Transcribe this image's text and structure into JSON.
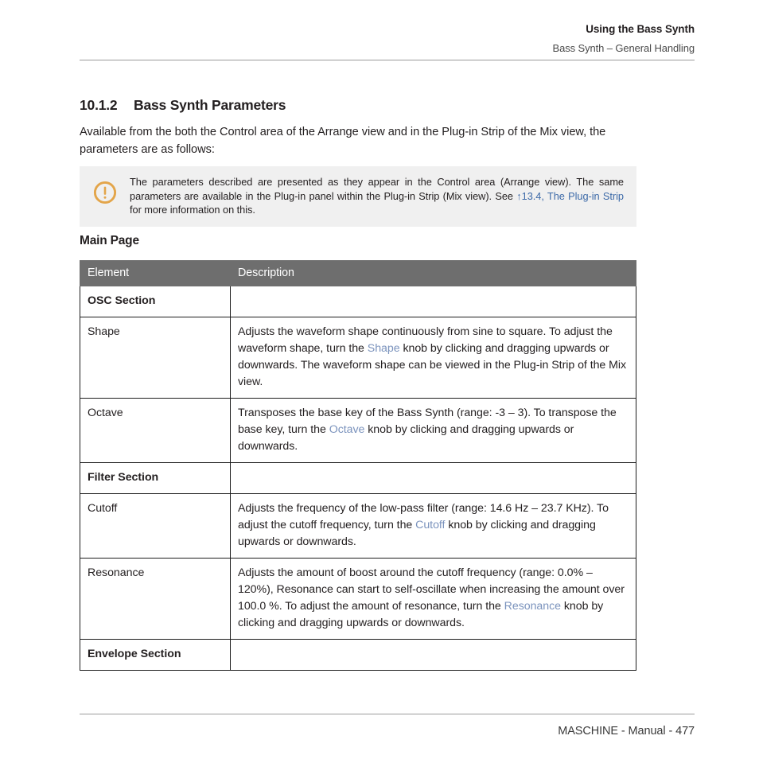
{
  "header": {
    "title": "Using the Bass Synth",
    "subtitle": "Bass Synth – General Handling"
  },
  "section": {
    "number": "10.1.2",
    "title": "Bass Synth Parameters"
  },
  "intro": "Available from the both the Control area of the Arrange view and in the Plug-in Strip of the Mix view, the parameters are as follows:",
  "note": {
    "icon": "exclamation-circle-icon",
    "icon_color": "#e3a54a",
    "text_part1": "The parameters described are presented as they appear in the Control area (Arrange view). The same parameters are available in the Plug-in panel within the Plug-in Strip (Mix view). See ",
    "link_text": "↑13.4, The Plug-in Strip",
    "text_part2": " for more information on this."
  },
  "subheading": "Main Page",
  "table": {
    "columns": [
      "Element",
      "Description"
    ],
    "header_bg": "#6e6e6e",
    "param_color": "#7b93bd",
    "rows": [
      {
        "type": "section",
        "element": "OSC Section",
        "description": ""
      },
      {
        "type": "param",
        "element": "Shape",
        "desc_a": "Adjusts the waveform shape continuously from sine to square. To adjust the waveform shape, turn the ",
        "desc_name": "Shape",
        "desc_b": " knob by clicking and dragging upwards or downwards. The waveform shape can be viewed in the Plug-in Strip of the Mix view."
      },
      {
        "type": "param",
        "element": "Octave",
        "desc_a": "Transposes the base key of the Bass Synth (range: -3 – 3). To transpose the base key, turn the ",
        "desc_name": "Octave",
        "desc_b": " knob by clicking and dragging upwards or downwards."
      },
      {
        "type": "section",
        "element": "Filter Section",
        "description": ""
      },
      {
        "type": "param",
        "element": "Cutoff",
        "desc_a": "Adjusts the frequency of the low-pass filter (range: 14.6 Hz – 23.7 KHz). To adjust the cutoff frequency, turn the ",
        "desc_name": "Cutoff",
        "desc_b": " knob by clicking and dragging upwards or downwards."
      },
      {
        "type": "param",
        "element": "Resonance",
        "desc_a": "Adjusts the amount of boost around the cutoff frequency (range: 0.0% – 120%), Resonance can start to self-oscillate when increasing the amount over 100.0 %. To adjust the amount of resonance, turn the ",
        "desc_name": "Resonance",
        "desc_b": " knob by clicking and dragging upwards or downwards."
      },
      {
        "type": "section",
        "element": "Envelope Section",
        "description": ""
      }
    ]
  },
  "footer": "MASCHINE - Manual - 477"
}
